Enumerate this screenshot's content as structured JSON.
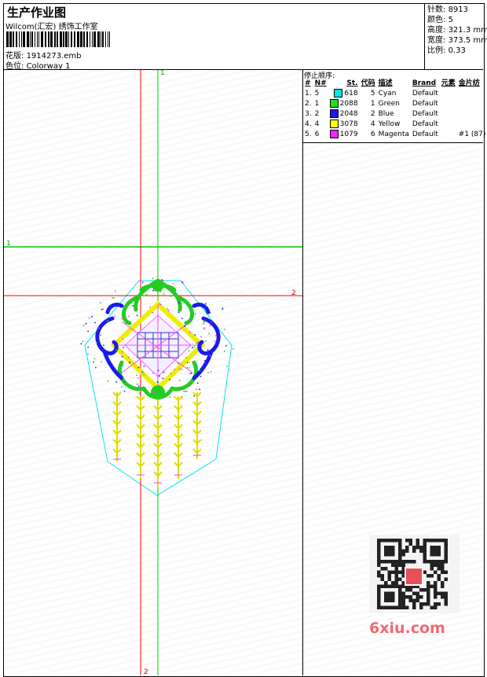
{
  "header": {
    "title": "生产作业图",
    "subtitle": "Wilcom(汇宏) 绣饰工作室",
    "design_label": "花版:",
    "design_file": "1914273.emb",
    "colorway_label": "色位:",
    "colorway": "Colorway 1"
  },
  "stats": {
    "stitches_label": "针数:",
    "stitches": "8913",
    "colors_label": "颜色:",
    "colors": "5",
    "height_label": "高度:",
    "height": "321.3 mm",
    "width_label": "宽度:",
    "width": "373.5 mm",
    "scale_label": "比例:",
    "scale": "0.33"
  },
  "sequence": {
    "title": "停止顺序:",
    "headers": [
      "#",
      "N#",
      "St.",
      "代码",
      "描述",
      "Brand",
      "元素",
      "金片纺"
    ],
    "rows": [
      {
        "no": "1.",
        "n": "5",
        "color": "#00e5ee",
        "st": "618",
        "code": "5",
        "desc": "Cyan",
        "brand": "Default",
        "elem": "",
        "extra": ""
      },
      {
        "no": "2.",
        "n": "1",
        "color": "#22dd22",
        "st": "2088",
        "code": "1",
        "desc": "Green",
        "brand": "Default",
        "elem": "",
        "extra": ""
      },
      {
        "no": "3.",
        "n": "2",
        "color": "#1a1aee",
        "st": "2048",
        "code": "2",
        "desc": "Blue",
        "brand": "Default",
        "elem": "",
        "extra": ""
      },
      {
        "no": "4.",
        "n": "4",
        "color": "#ffff00",
        "st": "3078",
        "code": "4",
        "desc": "Yellow",
        "brand": "Default",
        "elem": "",
        "extra": ""
      },
      {
        "no": "5.",
        "n": "6",
        "color": "#ff22ff",
        "st": "1079",
        "code": "6",
        "desc": "Magenta",
        "brand": "Default",
        "elem": "",
        "extra": "#1 (87)"
      }
    ]
  },
  "guides": {
    "v_green_label": "1",
    "h_green_label": "1",
    "h_red_label": "2",
    "v_red_label": "2"
  },
  "watermark": {
    "site": "6xiu.com"
  },
  "colors": {
    "cyan": "#00e5ee",
    "green": "#22dd22",
    "blue": "#1a1aee",
    "yellow": "#ffff00",
    "magenta": "#ff22ff",
    "red_guide": "#ff0000",
    "green_guide": "#00cc00"
  }
}
